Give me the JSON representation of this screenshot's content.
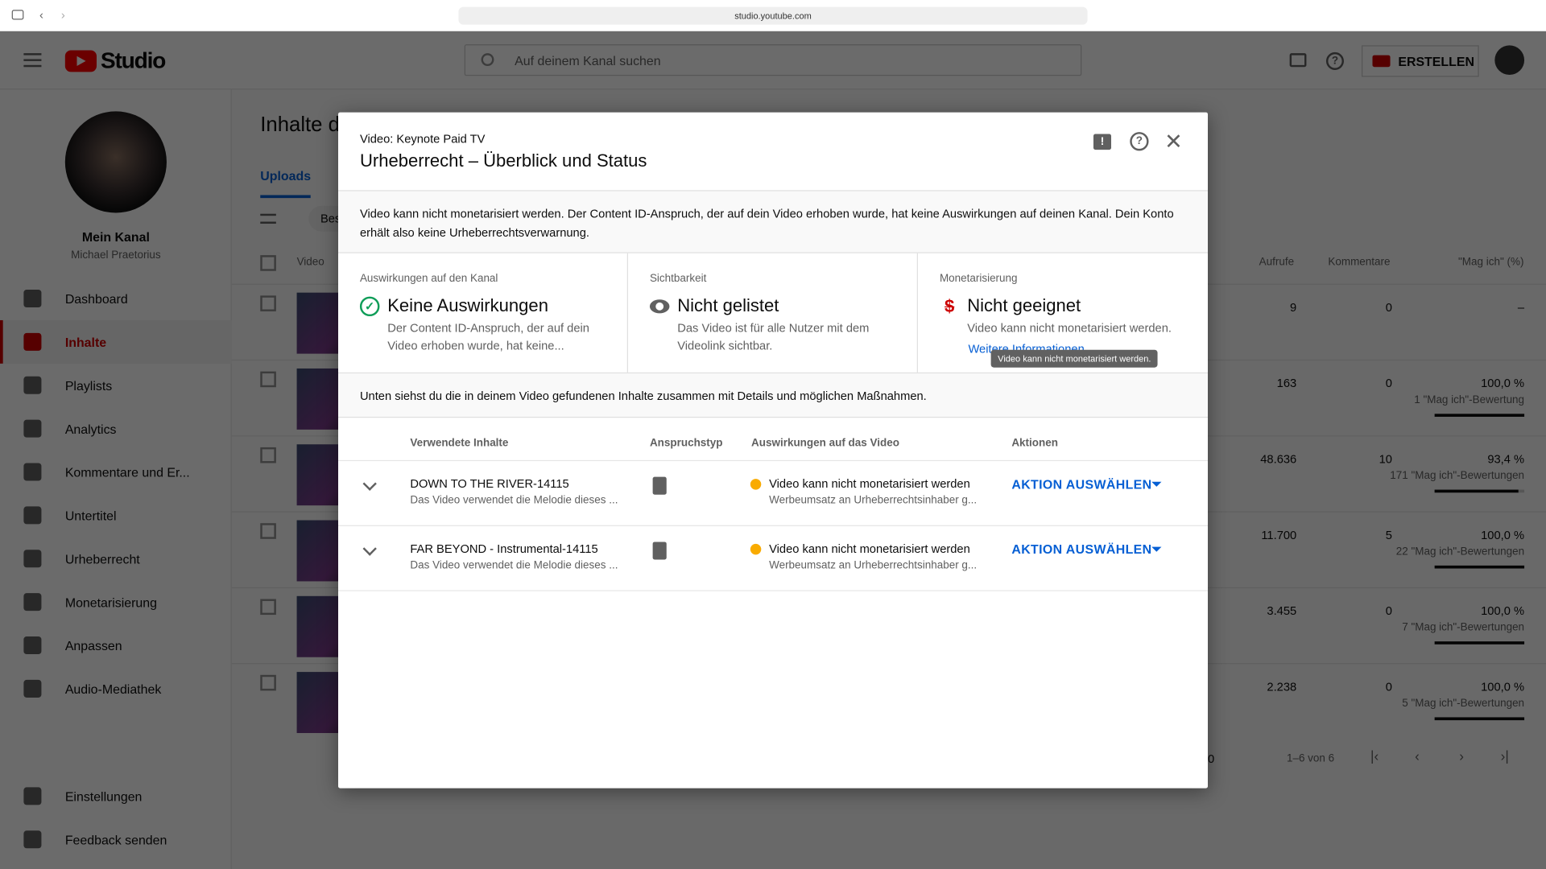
{
  "browser": {
    "url": "studio.youtube.com"
  },
  "header": {
    "logo": "Studio",
    "search_placeholder": "Auf deinem Kanal suchen",
    "create_label": "ERSTELLEN"
  },
  "sidebar": {
    "channel_title": "Mein Kanal",
    "channel_name": "Michael Praetorius",
    "items": [
      {
        "label": "Dashboard",
        "icon": "dashboard-icon"
      },
      {
        "label": "Inhalte",
        "icon": "content-icon",
        "active": true
      },
      {
        "label": "Playlists",
        "icon": "playlists-icon"
      },
      {
        "label": "Analytics",
        "icon": "analytics-icon"
      },
      {
        "label": "Kommentare und Er...",
        "icon": "comments-icon"
      },
      {
        "label": "Untertitel",
        "icon": "subtitles-icon"
      },
      {
        "label": "Urheberrecht",
        "icon": "copyright-icon"
      },
      {
        "label": "Monetarisierung",
        "icon": "dollar-icon"
      },
      {
        "label": "Anpassen",
        "icon": "customize-icon"
      },
      {
        "label": "Audio-Mediathek",
        "icon": "audio-library-icon"
      }
    ],
    "bottom": [
      {
        "label": "Einstellungen",
        "icon": "gear-icon"
      },
      {
        "label": "Feedback senden",
        "icon": "feedback-icon"
      }
    ]
  },
  "page": {
    "title": "Inhalte d",
    "tab": "Uploads",
    "filter_chip": "Bes",
    "col_video": "Video",
    "col_views": "Aufrufe",
    "col_comments": "Kommentare",
    "col_likes": "\"Mag ich\" (%)",
    "rows": [
      {
        "views": "9",
        "comments": "0",
        "likes": "–",
        "likes_sub": "",
        "like_fraction": 0
      },
      {
        "views": "163",
        "comments": "0",
        "likes": "100,0 %",
        "likes_sub": "1 \"Mag ich\"-Bewertung",
        "like_fraction": 1
      },
      {
        "views": "48.636",
        "comments": "10",
        "likes": "93,4 %",
        "likes_sub": "171 \"Mag ich\"-Bewertungen",
        "like_fraction": 0.934
      },
      {
        "views": "11.700",
        "comments": "5",
        "likes": "100,0 %",
        "likes_sub": "22 \"Mag ich\"-Bewertungen",
        "like_fraction": 1
      },
      {
        "views": "3.455",
        "comments": "0",
        "likes": "100,0 %",
        "likes_sub": "7 \"Mag ich\"-Bewertungen",
        "like_fraction": 1
      },
      {
        "views": "2.238",
        "comments": "0",
        "likes": "100,0 %",
        "likes_sub": "5 \"Mag ich\"-Bewertungen",
        "like_fraction": 1
      }
    ],
    "pagination": {
      "per_page": "0",
      "range": "1–6 von 6"
    }
  },
  "dialog": {
    "subtitle": "Video: Keynote Paid TV",
    "title": "Urheberrecht – Überblick und Status",
    "notice": "Video kann nicht monetarisiert werden. Der Content ID-Anspruch, der auf dein Video erhoben wurde, hat keine Auswirkungen auf deinen Kanal. Dein Konto erhält also keine Urheberrechtsverwarnung.",
    "status": [
      {
        "label": "Auswirkungen auf den Kanal",
        "value": "Keine Auswirkungen",
        "desc": "Der Content ID-Anspruch, der auf dein Video erhoben wurde, hat keine...",
        "icon": "check-circle-icon",
        "color": "#0f9d58"
      },
      {
        "label": "Sichtbarkeit",
        "value": "Nicht gelistet",
        "desc": "Das Video ist für alle Nutzer mit dem Videolink sichtbar.",
        "icon": "eye-icon",
        "color": "#606060"
      },
      {
        "label": "Monetarisierung",
        "value": "Nicht geeignet",
        "desc": "Video kann nicht monetarisiert werden.",
        "link": "Weitere Informationen",
        "icon": "no-money-icon",
        "color": "#cc0000"
      }
    ],
    "tooltip": "Video kann nicht monetarisiert werden.",
    "found_text": "Unten siehst du die in deinem Video gefundenen Inhalte zusammen mit Details und möglichen Maßnahmen.",
    "columns": [
      "Verwendete Inhalte",
      "Anspruchstyp",
      "Auswirkungen auf das Video",
      "Aktionen"
    ],
    "claims": [
      {
        "title": "DOWN TO THE RIVER-14115",
        "desc": "Das Video verwendet die Melodie dieses ...",
        "type_icon": "music-note-icon",
        "impact": "Video kann nicht monetarisiert werden",
        "impact_sub": "Werbeumsatz an Urheberrechtsinhaber g...",
        "action": "AKTION AUSWÄHLEN"
      },
      {
        "title": "FAR BEYOND - Instrumental-14115",
        "desc": "Das Video verwendet die Melodie dieses ...",
        "type_icon": "music-note-icon",
        "impact": "Video kann nicht monetarisiert werden",
        "impact_sub": "Werbeumsatz an Urheberrechtsinhaber g...",
        "action": "AKTION AUSWÄHLEN"
      }
    ]
  },
  "colors": {
    "accent": "#065fd4",
    "brand": "#ff0000",
    "warning": "#f9ab00"
  }
}
